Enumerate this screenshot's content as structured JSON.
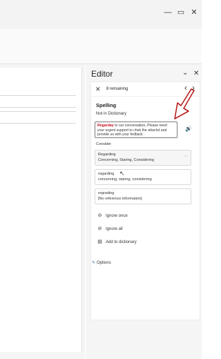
{
  "window": {
    "minimize_glyph": "—",
    "maximize_glyph": "▭",
    "close_glyph": "✕"
  },
  "editor": {
    "title": "Editor",
    "collapse_glyph": "⌄",
    "close_glyph": "✕",
    "remaining_label": "8 remaining",
    "prev_glyph": "‹",
    "next_glyph": "›",
    "issue_close_glyph": "✕",
    "category": "Spelling",
    "issue_type": "Not in Dictionary",
    "context": {
      "error_word": "Regarday",
      "rest": " to our conversation, Please need your urgent support to chek the attachd and provide us with your fedback ."
    },
    "speaker_glyph": "🔊",
    "consider_label": "Consider",
    "suggestions": [
      {
        "word": "Regarding",
        "detail": "Concerning, Staring, Considering",
        "more": "⋯"
      },
      {
        "word": "regarding",
        "detail": "concerning, staring, considering"
      },
      {
        "word": "regrading",
        "detail": "[No reference information]"
      }
    ],
    "actions": [
      {
        "label": "Ignore once",
        "icon": "⊘"
      },
      {
        "label": "Ignore all",
        "icon": "⊘"
      },
      {
        "label": "Add to dictionary",
        "icon": "▤"
      }
    ],
    "options_label": "Options"
  },
  "colors": {
    "error": "#c50f1f",
    "annotation_arrow": "#b91c1c"
  }
}
